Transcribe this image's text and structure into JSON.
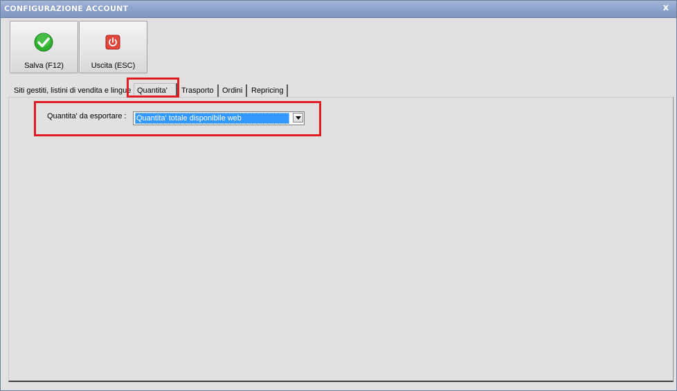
{
  "window": {
    "title": "CONFIGURAZIONE ACCOUNT",
    "close_glyph": "x"
  },
  "toolbar": {
    "save_label": "Salva (F12)",
    "save_icon": "green-check-icon",
    "exit_label": "Uscita (ESC)",
    "exit_icon": "red-power-icon"
  },
  "tabs": [
    {
      "label": "Siti gestiti, listini di vendita e lingue",
      "selected": false
    },
    {
      "label": "Quantita'",
      "selected": true
    },
    {
      "label": "Trasporto",
      "selected": false
    },
    {
      "label": "Ordini",
      "selected": false
    },
    {
      "label": "Repricing",
      "selected": false
    }
  ],
  "form": {
    "quantity_label": "Quantita' da esportare :",
    "quantity_value": "Quantita' totale disponibile web"
  },
  "colors": {
    "highlight": "#e01b24",
    "selection": "#3399ff",
    "titlebar": "#8ea5cc"
  }
}
